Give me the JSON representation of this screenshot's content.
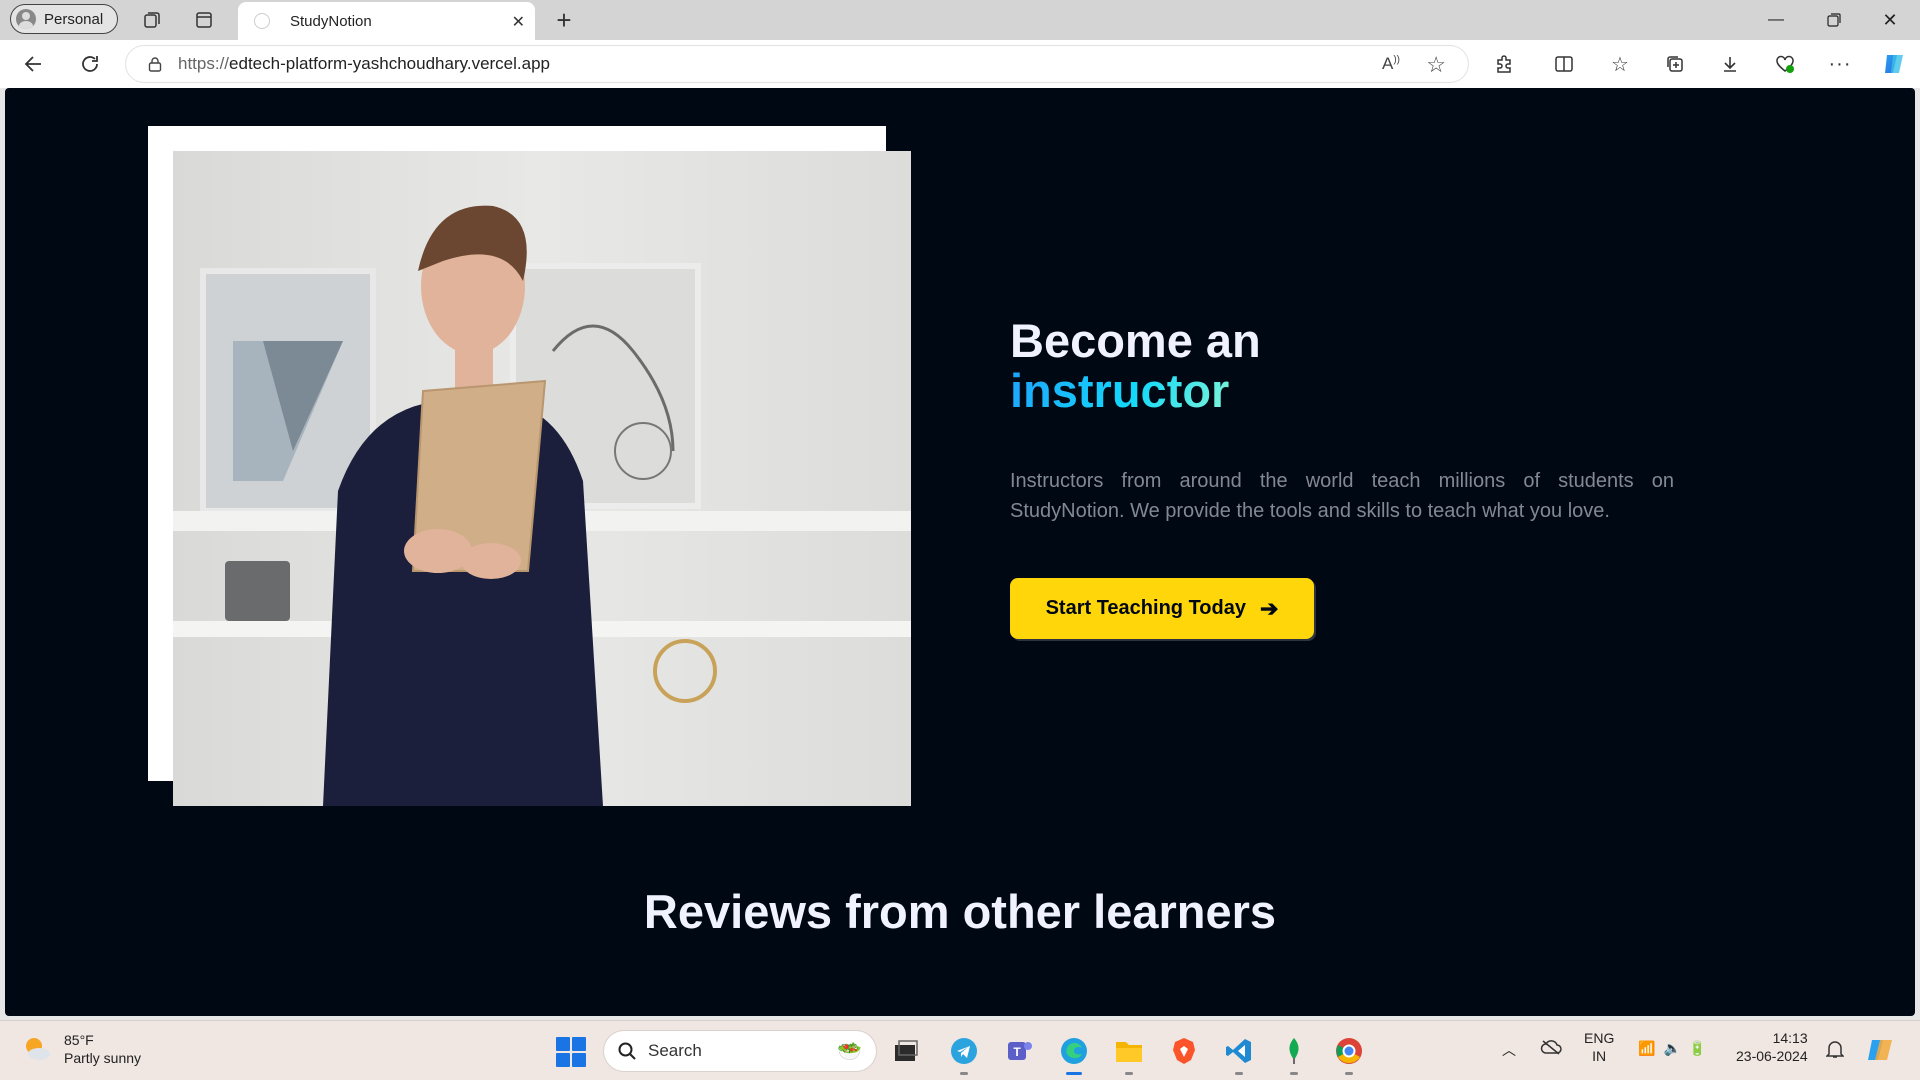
{
  "browser": {
    "profile_label": "Personal",
    "tab_title": "StudyNotion",
    "url_scheme": "https://",
    "url_host": "edtech-platform-yashchoudhary.vercel.app"
  },
  "hero": {
    "headline_line1": "Become an",
    "headline_accent": "instructor",
    "description": "Instructors from around the world teach millions of students on StudyNotion. We provide the tools and skills to teach what you love.",
    "cta_label": "Start Teaching Today"
  },
  "reviews": {
    "heading": "Reviews from other learners"
  },
  "taskbar": {
    "weather_temp": "85°F",
    "weather_desc": "Partly sunny",
    "search_placeholder": "Search",
    "lang_top": "ENG",
    "lang_bottom": "IN",
    "time": "14:13",
    "date": "23-06-2024"
  },
  "colors": {
    "page_bg": "#000814",
    "cta_bg": "#ffd60a",
    "headline": "#f1f2ff",
    "accent": "#12d8fa",
    "description": "#838894"
  },
  "icons": [
    "workspaces-icon",
    "tab-actions-icon",
    "new-tab-icon",
    "back-icon",
    "refresh-icon",
    "lock-icon",
    "read-aloud-icon",
    "favorite-star-icon",
    "extensions-icon",
    "split-screen-icon",
    "favorites-icon",
    "collections-icon",
    "downloads-icon",
    "browser-essentials-icon",
    "more-icon",
    "copilot-icon"
  ]
}
